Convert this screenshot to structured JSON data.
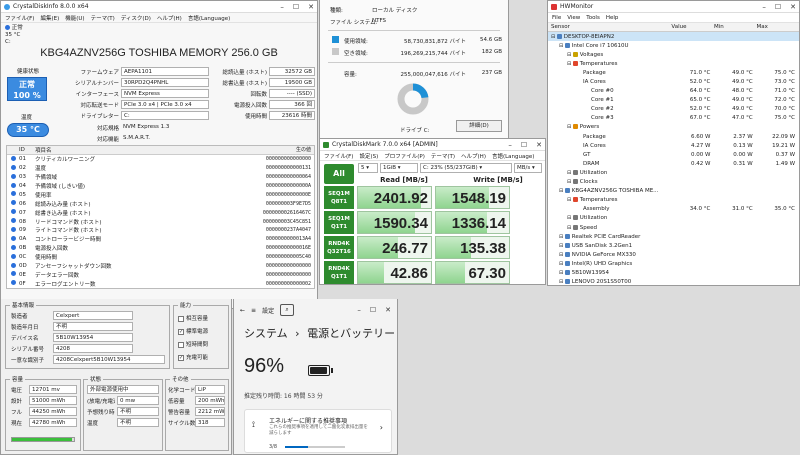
{
  "cdi": {
    "title": "CrystalDiskInfo 8.0.0 x64",
    "menu": [
      "ファイル(F)",
      "編集(E)",
      "機能(U)",
      "テーマ(T)",
      "ディスク(D)",
      "ヘルプ(H)",
      "言語(Language)"
    ],
    "drive_status": "正常",
    "drive_temp": "35 °C",
    "drive_letter": "C:",
    "model": "KBG4AZNV256G TOSHIBA MEMORY 256.0 GB",
    "health_label": "健康状態",
    "health_status": "正常",
    "health_pct": "100 %",
    "temp_label": "温度",
    "temp_value": "35 °C",
    "left_fields": [
      {
        "label": "ファームウェア",
        "value": "AEPA1101"
      },
      {
        "label": "シリアルナンバー",
        "value": "30RPD2Q4PNHL"
      },
      {
        "label": "インターフェース",
        "value": "NVM Express"
      },
      {
        "label": "対応転送モード",
        "value": "PCIe 3.0 x4 | PCIe 3.0 x4"
      },
      {
        "label": "ドライブレター",
        "value": "C:"
      }
    ],
    "right_fields": [
      {
        "label": "総読込量 (ホスト)",
        "value": "32572 GB"
      },
      {
        "label": "総書込量 (ホスト)",
        "value": "19500 GB"
      },
      {
        "label": "回転数",
        "value": "---- (SSD)"
      },
      {
        "label": "電源投入回数",
        "value": "366 回"
      },
      {
        "label": "使用時間",
        "value": "23616 時間"
      }
    ],
    "std_label": "対応規格",
    "std_value": "NVM Express 1.3",
    "feat_label": "対応機能",
    "feat_value": "S.M.A.R.T.",
    "smart_headers": [
      "ID",
      "項目名",
      "生の値"
    ],
    "smart": [
      {
        "id": "01",
        "name": "クリティカルワーニング",
        "raw": "000000000000000"
      },
      {
        "id": "02",
        "name": "温度",
        "raw": "000000000000131"
      },
      {
        "id": "03",
        "name": "予備領域",
        "raw": "000000000000064"
      },
      {
        "id": "04",
        "name": "予備領域 (しきい値)",
        "raw": "00000000000000A"
      },
      {
        "id": "05",
        "name": "使用率",
        "raw": "00000000000000E"
      },
      {
        "id": "06",
        "name": "総読み込み量 (ホスト)",
        "raw": "000000003F9E7D5"
      },
      {
        "id": "07",
        "name": "総書き込み量 (ホスト)",
        "raw": "000000002616467C"
      },
      {
        "id": "08",
        "name": "リードコマンド数 (ホスト)",
        "raw": "000000003C45C851"
      },
      {
        "id": "09",
        "name": "ライトコマンド数 (ホスト)",
        "raw": "0000000237A4047"
      },
      {
        "id": "0A",
        "name": "コントローラービジー時間",
        "raw": "0000000000013A4"
      },
      {
        "id": "0B",
        "name": "電源投入回数",
        "raw": "00000000000016E"
      },
      {
        "id": "0C",
        "name": "使用時間",
        "raw": "000000000005C40"
      },
      {
        "id": "0D",
        "name": "アンセーフシャットダウン回数",
        "raw": "000000000000000"
      },
      {
        "id": "0E",
        "name": "データエラー回数",
        "raw": "000000000000000"
      },
      {
        "id": "0F",
        "name": "エラーログエントリー数",
        "raw": "000000000000002"
      }
    ]
  },
  "drive_props": {
    "filesystem_label": "ファイル システム:",
    "filesystem_value": "NTFS",
    "type_value": "ローカル ディスク",
    "type_label": "種類:",
    "used_label": "使用領域:",
    "used_bytes": "58,730,831,872 バイト",
    "used_gb": "54.6 GB",
    "free_label": "空き領域:",
    "free_bytes": "196,269,215,744 バイト",
    "free_gb": "182 GB",
    "cap_label": "容量:",
    "cap_bytes": "255,000,047,616 バイト",
    "cap_gb": "237 GB",
    "used_fraction": 0.23,
    "drive_label": "ドライブ C:",
    "details_button": "詳細(D)",
    "used_color": "#1e90d6",
    "free_color": "#c8c8c8"
  },
  "cdm": {
    "title": "CrystalDiskMark 7.0.0 x64 [ADMIN]",
    "menu": [
      "ファイル(F)",
      "設定(S)",
      "プロファイル(P)",
      "テーマ(T)",
      "ヘルプ(H)",
      "言語(Language)"
    ],
    "all_button": "All",
    "count": "5",
    "size": "1GiB",
    "drive": "C: 23% (55/237GiB)",
    "unit": "MB/s",
    "read_header": "Read [MB/s]",
    "write_header": "Write [MB/s]",
    "rows": [
      {
        "l1": "SEQ1M",
        "l2": "Q8T1",
        "read": "2401.92",
        "write": "1548.19",
        "rf": 0.86,
        "wf": 0.72
      },
      {
        "l1": "SEQ1M",
        "l2": "Q1T1",
        "read": "1590.34",
        "write": "1336.14",
        "rf": 0.78,
        "wf": 0.7
      },
      {
        "l1": "RND4K",
        "l2": "Q32T16",
        "read": "246.77",
        "write": "135.38",
        "rf": 0.55,
        "wf": 0.48
      },
      {
        "l1": "RND4K",
        "l2": "Q1T1",
        "read": "42.86",
        "write": "67.30",
        "rf": 0.36,
        "wf": 0.4
      }
    ]
  },
  "hwm": {
    "title": "HWMonitor",
    "menu": [
      "File",
      "View",
      "Tools",
      "Help"
    ],
    "headers": [
      "Sensor",
      "Value",
      "Min",
      "Max"
    ],
    "rows": [
      {
        "s": "DESKTOP-8EIAPN2",
        "v": "",
        "mn": "",
        "mx": "",
        "ind": 0,
        "sel": true
      },
      {
        "s": "Intel Core i7 10610U",
        "v": "",
        "mn": "",
        "mx": "",
        "ind": 1
      },
      {
        "s": "Voltages",
        "v": "",
        "mn": "",
        "mx": "",
        "ind": 2
      },
      {
        "s": "Temperatures",
        "v": "",
        "mn": "",
        "mx": "",
        "ind": 2
      },
      {
        "s": "Package",
        "v": "71.0 °C",
        "mn": "49.0 °C",
        "mx": "75.0 °C",
        "ind": 4
      },
      {
        "s": "IA Cores",
        "v": "52.0 °C",
        "mn": "49.0 °C",
        "mx": "73.0 °C",
        "ind": 4
      },
      {
        "s": "Core #0",
        "v": "64.0 °C",
        "mn": "48.0 °C",
        "mx": "71.0 °C",
        "ind": 5
      },
      {
        "s": "Core #1",
        "v": "65.0 °C",
        "mn": "49.0 °C",
        "mx": "72.0 °C",
        "ind": 5
      },
      {
        "s": "Core #2",
        "v": "52.0 °C",
        "mn": "49.0 °C",
        "mx": "70.0 °C",
        "ind": 5
      },
      {
        "s": "Core #3",
        "v": "67.0 °C",
        "mn": "47.0 °C",
        "mx": "75.0 °C",
        "ind": 5
      },
      {
        "s": "Powers",
        "v": "",
        "mn": "",
        "mx": "",
        "ind": 2
      },
      {
        "s": "Package",
        "v": "6.60 W",
        "mn": "2.37 W",
        "mx": "22.09 W",
        "ind": 4
      },
      {
        "s": "IA Cores",
        "v": "4.27 W",
        "mn": "0.13 W",
        "mx": "19.21 W",
        "ind": 4
      },
      {
        "s": "GT",
        "v": "0.00 W",
        "mn": "0.00 W",
        "mx": "0.37 W",
        "ind": 4
      },
      {
        "s": "DRAM",
        "v": "0.42 W",
        "mn": "0.31 W",
        "mx": "1.49 W",
        "ind": 4
      },
      {
        "s": "Utilization",
        "v": "",
        "mn": "",
        "mx": "",
        "ind": 2
      },
      {
        "s": "Clocks",
        "v": "",
        "mn": "",
        "mx": "",
        "ind": 2
      },
      {
        "s": "KBG4AZNV256G TOSHIBA ME...",
        "v": "",
        "mn": "",
        "mx": "",
        "ind": 1
      },
      {
        "s": "Temperatures",
        "v": "",
        "mn": "",
        "mx": "",
        "ind": 2
      },
      {
        "s": "Assembly",
        "v": "34.0 °C",
        "mn": "31.0 °C",
        "mx": "35.0 °C",
        "ind": 4
      },
      {
        "s": "Utilization",
        "v": "",
        "mn": "",
        "mx": "",
        "ind": 2
      },
      {
        "s": "Speed",
        "v": "",
        "mn": "",
        "mx": "",
        "ind": 2
      },
      {
        "s": "Realtek PCIE CardReader",
        "v": "",
        "mn": "",
        "mx": "",
        "ind": 1
      },
      {
        "s": "USB  SanDisk 3.2Gen1",
        "v": "",
        "mn": "",
        "mx": "",
        "ind": 1
      },
      {
        "s": "NVIDIA GeForce MX330",
        "v": "",
        "mn": "",
        "mx": "",
        "ind": 1
      },
      {
        "s": "Intel(R) UHD Graphics",
        "v": "",
        "mn": "",
        "mx": "",
        "ind": 1
      },
      {
        "s": "5B10W13954",
        "v": "",
        "mn": "",
        "mx": "",
        "ind": 1
      },
      {
        "s": "LENOVO 20S1S50T00",
        "v": "",
        "mn": "",
        "mx": "",
        "ind": 1
      }
    ]
  },
  "batt": {
    "basic_title": "基本情報",
    "basic": [
      {
        "label": "製造者",
        "value": "Celxpert"
      },
      {
        "label": "製造年月日",
        "value": "不明"
      },
      {
        "label": "デバイス名",
        "value": "5B10W13954"
      },
      {
        "label": "シリアル番号",
        "value": "4208"
      },
      {
        "label": "一意な識別子",
        "value": "4208Celxpert5B10W13954"
      }
    ],
    "func_title": "能力",
    "funcs": [
      {
        "label": "相互容量",
        "checked": ""
      },
      {
        "label": "標準電源",
        "checked": "✓"
      },
      {
        "label": "短時間問",
        "checked": ""
      },
      {
        "label": "充電可能",
        "checked": "✓"
      }
    ],
    "cap_title": "容量",
    "caps": [
      {
        "label": "電圧",
        "value": "12701 mv"
      },
      {
        "label": "設計",
        "value": "51000 mWh"
      },
      {
        "label": "フル",
        "value": "44250 mWh"
      },
      {
        "label": "現在",
        "value": "42780 mWh"
      }
    ],
    "state_title": "状態",
    "state": [
      {
        "label": "",
        "value": "外部電源使用中"
      },
      {
        "label": "(放電/充電速度",
        "value": "0 mw"
      },
      {
        "label": "予想残り時間",
        "value": "不明"
      },
      {
        "label": "温度",
        "value": "不明"
      }
    ],
    "other_title": "その他",
    "other": [
      {
        "label": "化学コード",
        "value": "LiP"
      },
      {
        "label": "低容量",
        "value": "200 mWh"
      },
      {
        "label": "警告容量",
        "value": "2212 mWh"
      },
      {
        "label": "サイクル数",
        "value": "318"
      }
    ],
    "current_fraction": 0.967
  },
  "settings": {
    "app": "設定",
    "crumb1": "システム",
    "sep": "›",
    "crumb2": "電源とバッテリー",
    "percent": "96%",
    "remaining": "推定残り時間: 16 時間 53 分",
    "rec_title": "エネルギーに関する推奨事項",
    "rec_desc": "これらの推奨事項を適用して二酸化炭素排出量を減らします",
    "rec_progress": "3/8",
    "battery_level": 0.96
  }
}
